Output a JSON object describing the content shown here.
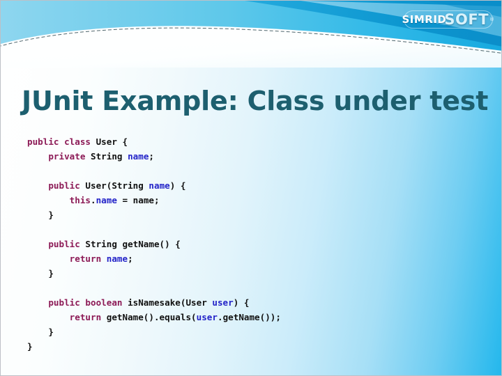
{
  "slide": {
    "title": "JUnit Example: Class under test",
    "logo": {
      "part1": "Simrid",
      "part2": "Soft",
      "trademark": "®"
    },
    "theme": {
      "title_color": "#1d5f6f",
      "accent_cyan": "#24b7ec",
      "banner_dark_blue": "#0c8fcc",
      "banner_mid_blue": "#2ab6e6",
      "banner_pale_blue": "#9ad9ef",
      "code_keyword_color": "#8c1a56",
      "code_identifier_color": "#2323c8",
      "code_plain_color": "#111111",
      "background_left": "#ffffff",
      "background_right": "#24b7ec"
    }
  },
  "code": {
    "language": "java",
    "lines": [
      {
        "tokens": [
          {
            "t": "public class ",
            "c": "kw"
          },
          {
            "t": "User {",
            "c": "pl"
          }
        ]
      },
      {
        "tokens": [
          {
            "t": "    private ",
            "c": "kw"
          },
          {
            "t": "String ",
            "c": "pl"
          },
          {
            "t": "name",
            "c": "id"
          },
          {
            "t": ";",
            "c": "pl"
          }
        ]
      },
      {
        "tokens": [
          {
            "t": "",
            "c": "pl"
          }
        ]
      },
      {
        "tokens": [
          {
            "t": "    public ",
            "c": "kw"
          },
          {
            "t": "User(String ",
            "c": "pl"
          },
          {
            "t": "name",
            "c": "id"
          },
          {
            "t": ") {",
            "c": "pl"
          }
        ]
      },
      {
        "tokens": [
          {
            "t": "        this",
            "c": "kw"
          },
          {
            "t": ".",
            "c": "pl"
          },
          {
            "t": "name",
            "c": "id"
          },
          {
            "t": " = name;",
            "c": "pl"
          }
        ]
      },
      {
        "tokens": [
          {
            "t": "    }",
            "c": "pl"
          }
        ]
      },
      {
        "tokens": [
          {
            "t": "",
            "c": "pl"
          }
        ]
      },
      {
        "tokens": [
          {
            "t": "    public ",
            "c": "kw"
          },
          {
            "t": "String getName() {",
            "c": "pl"
          }
        ]
      },
      {
        "tokens": [
          {
            "t": "        return ",
            "c": "kw"
          },
          {
            "t": "name",
            "c": "id"
          },
          {
            "t": ";",
            "c": "pl"
          }
        ]
      },
      {
        "tokens": [
          {
            "t": "    }",
            "c": "pl"
          }
        ]
      },
      {
        "tokens": [
          {
            "t": "",
            "c": "pl"
          }
        ]
      },
      {
        "tokens": [
          {
            "t": "    public boolean ",
            "c": "kw"
          },
          {
            "t": "isNamesake(User ",
            "c": "pl"
          },
          {
            "t": "user",
            "c": "id"
          },
          {
            "t": ") {",
            "c": "pl"
          }
        ]
      },
      {
        "tokens": [
          {
            "t": "        return ",
            "c": "kw"
          },
          {
            "t": "getName().equals(",
            "c": "pl"
          },
          {
            "t": "user",
            "c": "id"
          },
          {
            "t": ".getName());",
            "c": "pl"
          }
        ]
      },
      {
        "tokens": [
          {
            "t": "    }",
            "c": "pl"
          }
        ]
      },
      {
        "tokens": [
          {
            "t": "}",
            "c": "pl"
          }
        ]
      }
    ]
  }
}
